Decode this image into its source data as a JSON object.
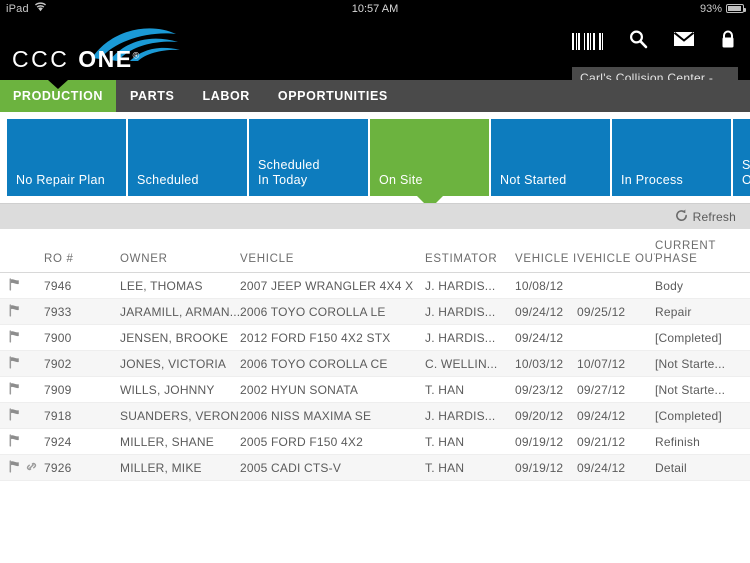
{
  "status_bar": {
    "device": "iPad",
    "wifi_icon": "wifi-icon",
    "time": "10:57 AM",
    "battery_pct": "93%",
    "battery_icon": "battery-icon"
  },
  "header": {
    "logo_ccc": "CCC",
    "logo_one": "ONE",
    "logo_reg": "®",
    "icons": [
      {
        "name": "barcode-icon",
        "label": "Barcode"
      },
      {
        "name": "search-icon",
        "label": "Search"
      },
      {
        "name": "mail-icon",
        "label": "Mail"
      },
      {
        "name": "lock-icon",
        "label": "Lock"
      }
    ],
    "organization": "Carl's Collision Center -..."
  },
  "nav": {
    "tabs": [
      {
        "label": "PRODUCTION",
        "active": true
      },
      {
        "label": "PARTS",
        "active": false
      },
      {
        "label": "LABOR",
        "active": false
      },
      {
        "label": "OPPORTUNITIES",
        "active": false
      }
    ]
  },
  "tiles": [
    {
      "label": "No Repair Plan",
      "selected": false
    },
    {
      "label": "Scheduled",
      "selected": false
    },
    {
      "label": "Scheduled\nIn Today",
      "selected": false
    },
    {
      "label": "On Site",
      "selected": true
    },
    {
      "label": "Not Started",
      "selected": false
    },
    {
      "label": "In Process",
      "selected": false
    },
    {
      "label": "Sc\nOu",
      "selected": false
    }
  ],
  "toolbar": {
    "refresh_label": "Refresh",
    "refresh_icon": "refresh-icon"
  },
  "table": {
    "columns": {
      "flag": "",
      "ro": "RO #",
      "owner": "OWNER",
      "vehicle": "VEHICLE",
      "estimator": "ESTIMATOR",
      "vehicle_in": "VEHICLE IN",
      "vehicle_out": "VEHICLE OUT",
      "phase_line1": "CURRENT",
      "phase_line2": "PHASE"
    },
    "rows": [
      {
        "flag": "flag-icon",
        "link": false,
        "ro": "7946",
        "owner": "LEE, THOMAS",
        "vehicle": "2007 JEEP WRANGLER 4X4 X",
        "estimator": "J. HARDIS...",
        "vehicle_in": "10/08/12",
        "vehicle_out": "",
        "phase": "Body"
      },
      {
        "flag": "flag-icon",
        "link": false,
        "ro": "7933",
        "owner": "JARAMILL, ARMAN...",
        "vehicle": "2006 TOYO COROLLA LE",
        "estimator": "J. HARDIS...",
        "vehicle_in": "09/24/12",
        "vehicle_out": "09/25/12",
        "phase": "Repair"
      },
      {
        "flag": "flag-icon",
        "link": false,
        "ro": "7900",
        "owner": "JENSEN, BROOKE",
        "vehicle": "2012 FORD F150 4X2 STX",
        "estimator": "J. HARDIS...",
        "vehicle_in": "09/24/12",
        "vehicle_out": "",
        "phase": "[Completed]"
      },
      {
        "flag": "flag-icon",
        "link": false,
        "ro": "7902",
        "owner": "JONES, VICTORIA",
        "vehicle": "2006 TOYO COROLLA CE",
        "estimator": "C. WELLIN...",
        "vehicle_in": "10/03/12",
        "vehicle_out": "10/07/12",
        "phase": "[Not Starte..."
      },
      {
        "flag": "flag-icon",
        "link": false,
        "ro": "7909",
        "owner": "WILLS, JOHNNY",
        "vehicle": "2002 HYUN SONATA",
        "estimator": "T. HAN",
        "vehicle_in": "09/23/12",
        "vehicle_out": "09/27/12",
        "phase": "[Not Starte..."
      },
      {
        "flag": "flag-icon",
        "link": false,
        "ro": "7918",
        "owner": "SUANDERS, VERON...",
        "vehicle": "2006 NISS MAXIMA SE",
        "estimator": "J. HARDIS...",
        "vehicle_in": "09/20/12",
        "vehicle_out": "09/24/12",
        "phase": "[Completed]"
      },
      {
        "flag": "flag-icon",
        "link": false,
        "ro": "7924",
        "owner": "MILLER, SHANE",
        "vehicle": "2005 FORD F150 4X2",
        "estimator": "T. HAN",
        "vehicle_in": "09/19/12",
        "vehicle_out": "09/21/12",
        "phase": "Refinish"
      },
      {
        "flag": "flag-icon",
        "link": true,
        "ro": "7926",
        "owner": "MILLER, MIKE",
        "vehicle": "2005 CADI CTS-V",
        "estimator": "T. HAN",
        "vehicle_in": "09/19/12",
        "vehicle_out": "09/24/12",
        "phase": "Detail"
      }
    ]
  },
  "colors": {
    "brand_blue": "#0d7cbe",
    "brand_green": "#6cb33f",
    "header_black": "#000000",
    "nav_gray": "#4a4a4a",
    "toolbar_gray": "#dcdcdc"
  }
}
